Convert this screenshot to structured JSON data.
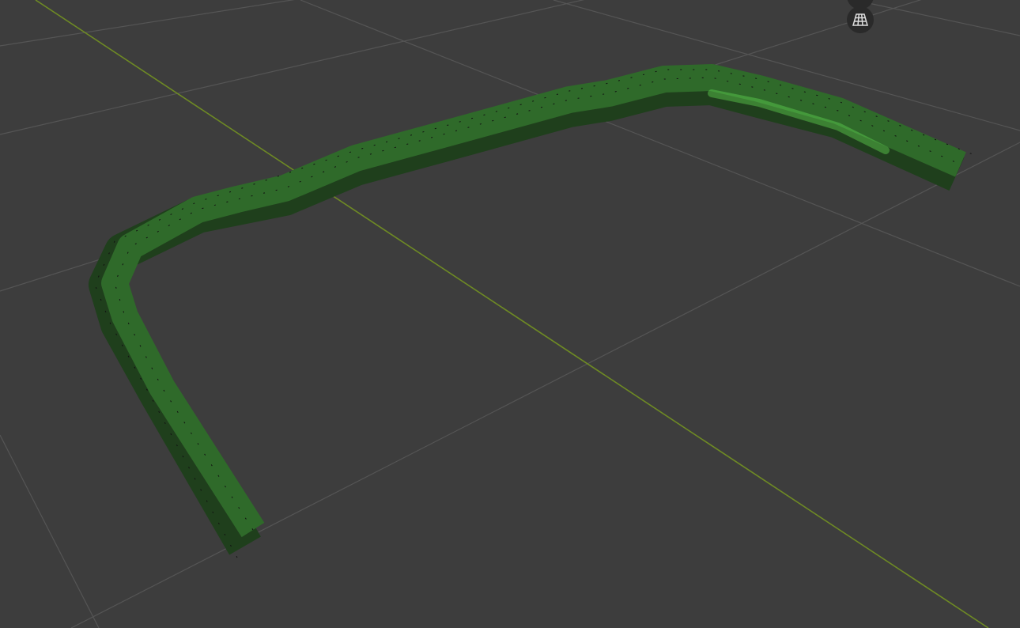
{
  "viewport": {
    "background": "#3d3d3d",
    "grid_color": "#555555",
    "axis_color": "#6e8a24",
    "mesh_color": "#2f6a2a",
    "mesh_highlight": "#5fd24f",
    "vertex_color": "#111111"
  },
  "gizmos": [
    {
      "icon": "navigation-gizmo-icon"
    },
    {
      "icon": "perspective-toggle-grid-icon"
    }
  ]
}
